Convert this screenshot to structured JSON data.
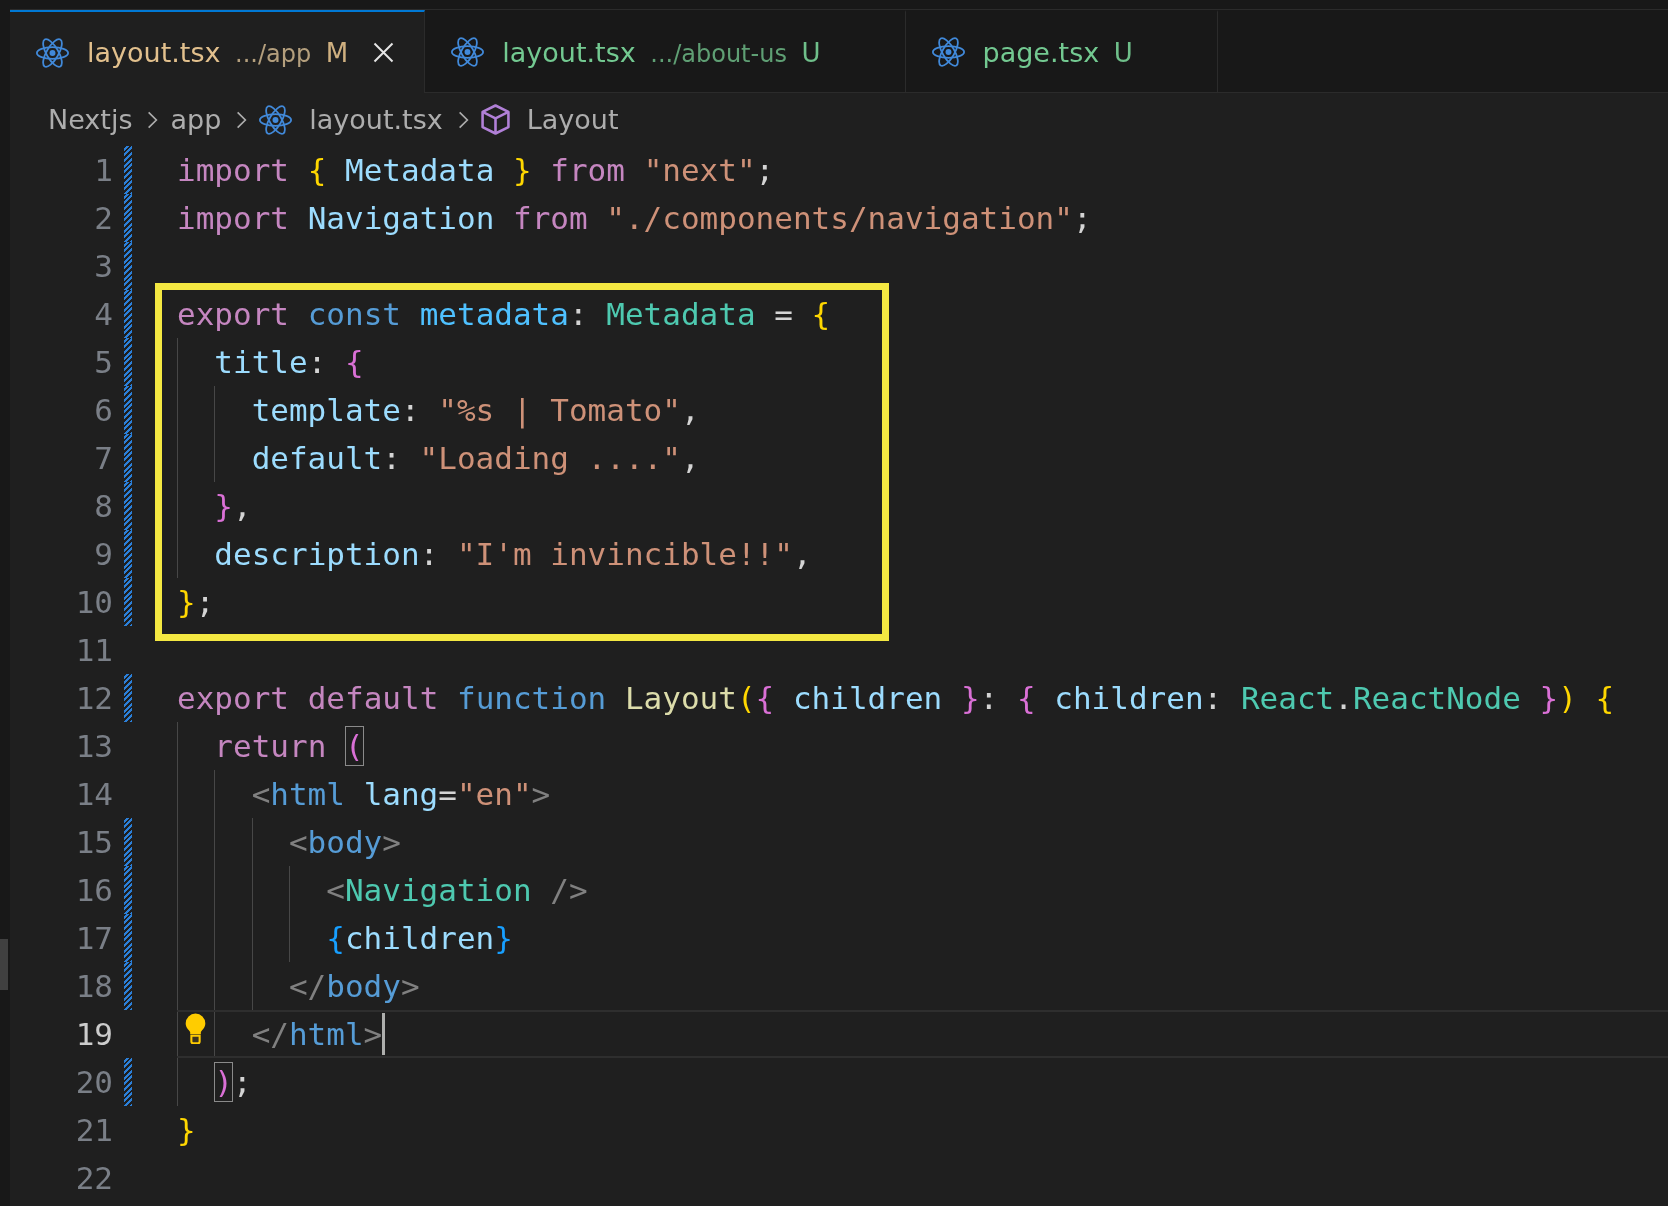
{
  "tabs": [
    {
      "file": "layout.tsx",
      "description": ".../app",
      "status": "M",
      "kind": "modified",
      "selected": true
    },
    {
      "file": "layout.tsx",
      "description": ".../about-us",
      "status": "U",
      "kind": "untracked",
      "selected": false
    },
    {
      "file": "page.tsx",
      "status": "U",
      "kind": "untracked",
      "selected": false
    }
  ],
  "breadcrumbs": [
    {
      "kind": "folder",
      "text": "Nextjs"
    },
    {
      "kind": "folder",
      "text": "app"
    },
    {
      "kind": "file",
      "text": "layout.tsx"
    },
    {
      "kind": "symbol",
      "text": "Layout"
    }
  ],
  "editor": {
    "lines": [
      {
        "kind": "line",
        "number": "1",
        "changed": true,
        "current": false,
        "lightbulb": false,
        "tokens": [
          {
            "text": "import ",
            "kind": "keyword"
          },
          {
            "text": "{ ",
            "kind": "bracket1"
          },
          {
            "text": "Metadata ",
            "kind": "variable"
          },
          {
            "text": "} ",
            "kind": "bracket1"
          },
          {
            "text": "from ",
            "kind": "keyword"
          },
          {
            "text": "\"next\"",
            "kind": "string"
          },
          {
            "text": ";",
            "kind": "punctuation"
          }
        ]
      },
      {
        "kind": "line",
        "number": "2",
        "changed": true,
        "current": false,
        "lightbulb": false,
        "tokens": [
          {
            "text": "import ",
            "kind": "keyword"
          },
          {
            "text": "Navigation ",
            "kind": "variable"
          },
          {
            "text": "from ",
            "kind": "keyword"
          },
          {
            "text": "\"./components/navigation\"",
            "kind": "string"
          },
          {
            "text": ";",
            "kind": "punctuation"
          }
        ]
      },
      {
        "kind": "line",
        "number": "3",
        "changed": true,
        "current": false,
        "lightbulb": false
      },
      {
        "kind": "highlight",
        "lines": [
          {
            "number": "4",
            "changed": true,
            "current": false,
            "lightbulb": false,
            "tokens": [
              {
                "text": "export ",
                "kind": "keyword"
              },
              {
                "text": "const ",
                "kind": "storage"
              },
              {
                "text": "metadata",
                "kind": "constant"
              },
              {
                "text": ": ",
                "kind": "punctuation"
              },
              {
                "text": "Metadata ",
                "kind": "type"
              },
              {
                "text": "= ",
                "kind": "punctuation"
              },
              {
                "text": "{",
                "kind": "bracket1"
              }
            ],
            "children": [
              {
                "number": "5",
                "changed": true,
                "current": false,
                "lightbulb": false,
                "tokens": [
                  {
                    "text": "title",
                    "kind": "property"
                  },
                  {
                    "text": ": ",
                    "kind": "punctuation"
                  },
                  {
                    "text": "{",
                    "kind": "bracket2"
                  }
                ],
                "children": [
                  {
                    "number": "6",
                    "changed": true,
                    "current": false,
                    "lightbulb": false,
                    "tokens": [
                      {
                        "text": "template",
                        "kind": "property"
                      },
                      {
                        "text": ": ",
                        "kind": "punctuation"
                      },
                      {
                        "text": "\"%s | Tomato\"",
                        "kind": "string"
                      },
                      {
                        "text": ",",
                        "kind": "punctuation"
                      }
                    ]
                  },
                  {
                    "number": "7",
                    "changed": true,
                    "current": false,
                    "lightbulb": false,
                    "tokens": [
                      {
                        "text": "default",
                        "kind": "property"
                      },
                      {
                        "text": ": ",
                        "kind": "punctuation"
                      },
                      {
                        "text": "\"Loading ....\"",
                        "kind": "string"
                      },
                      {
                        "text": ",",
                        "kind": "punctuation"
                      }
                    ]
                  }
                ]
              },
              {
                "number": "8",
                "changed": true,
                "current": false,
                "lightbulb": false,
                "tokens": [
                  {
                    "text": "}",
                    "kind": "bracket2"
                  },
                  {
                    "text": ",",
                    "kind": "punctuation"
                  }
                ]
              },
              {
                "number": "9",
                "changed": true,
                "current": false,
                "lightbulb": false,
                "tokens": [
                  {
                    "text": "description",
                    "kind": "property"
                  },
                  {
                    "text": ": ",
                    "kind": "punctuation"
                  },
                  {
                    "text": "\"I'm invincible!!\"",
                    "kind": "string"
                  },
                  {
                    "text": ",",
                    "kind": "punctuation"
                  }
                ]
              }
            ]
          },
          {
            "number": "10",
            "changed": true,
            "current": false,
            "lightbulb": false,
            "tokens": [
              {
                "text": "}",
                "kind": "bracket1"
              },
              {
                "text": ";",
                "kind": "punctuation"
              }
            ]
          }
        ]
      },
      {
        "kind": "line",
        "number": "11",
        "changed": false,
        "current": false,
        "lightbulb": false
      },
      {
        "kind": "line",
        "number": "12",
        "changed": true,
        "current": false,
        "lightbulb": false,
        "tokens": [
          {
            "text": "export ",
            "kind": "keyword"
          },
          {
            "text": "default ",
            "kind": "keyword"
          },
          {
            "text": "function ",
            "kind": "storage"
          },
          {
            "text": "Layout",
            "kind": "function"
          },
          {
            "text": "(",
            "kind": "bracket1"
          },
          {
            "text": "{ ",
            "kind": "bracket2"
          },
          {
            "text": "children ",
            "kind": "property"
          },
          {
            "text": "}",
            "kind": "bracket2"
          },
          {
            "text": ": ",
            "kind": "punctuation"
          },
          {
            "text": "{ ",
            "kind": "bracket2"
          },
          {
            "text": "children",
            "kind": "property"
          },
          {
            "text": ": ",
            "kind": "punctuation"
          },
          {
            "text": "React",
            "kind": "type"
          },
          {
            "text": ".",
            "kind": "punctuation"
          },
          {
            "text": "ReactNode ",
            "kind": "type"
          },
          {
            "text": "}",
            "kind": "bracket2"
          },
          {
            "text": ") {",
            "kind": "bracket1"
          }
        ],
        "children": [
          {
            "number": "13",
            "changed": false,
            "current": false,
            "lightbulb": false,
            "tokens": [
              {
                "text": "return ",
                "kind": "keyword"
              },
              {
                "text": "(",
                "kind": "bracket2",
                "matched": true
              }
            ],
            "children": [
              {
                "number": "14",
                "changed": false,
                "current": false,
                "lightbulb": false,
                "tokens": [
                  {
                    "text": "<",
                    "kind": "tag_bracket"
                  },
                  {
                    "text": "html ",
                    "kind": "tag"
                  },
                  {
                    "text": "lang",
                    "kind": "attribute"
                  },
                  {
                    "text": "=",
                    "kind": "punctuation"
                  },
                  {
                    "text": "\"en\"",
                    "kind": "string"
                  },
                  {
                    "text": ">",
                    "kind": "tag_bracket"
                  }
                ],
                "children": [
                  {
                    "number": "15",
                    "changed": true,
                    "current": false,
                    "lightbulb": false,
                    "tokens": [
                      {
                        "text": "<",
                        "kind": "tag_bracket"
                      },
                      {
                        "text": "body",
                        "kind": "tag"
                      },
                      {
                        "text": ">",
                        "kind": "tag_bracket"
                      }
                    ],
                    "children": [
                      {
                        "number": "16",
                        "changed": true,
                        "current": false,
                        "lightbulb": false,
                        "tokens": [
                          {
                            "text": "<",
                            "kind": "tag_bracket"
                          },
                          {
                            "text": "Navigation ",
                            "kind": "component"
                          },
                          {
                            "text": "/>",
                            "kind": "tag_bracket"
                          }
                        ]
                      },
                      {
                        "number": "17",
                        "changed": true,
                        "current": false,
                        "lightbulb": false,
                        "tokens": [
                          {
                            "text": "{",
                            "kind": "bracket3"
                          },
                          {
                            "text": "children",
                            "kind": "property"
                          },
                          {
                            "text": "}",
                            "kind": "bracket3"
                          }
                        ]
                      }
                    ]
                  },
                  {
                    "number": "18",
                    "changed": true,
                    "current": false,
                    "lightbulb": false,
                    "tokens": [
                      {
                        "text": "</",
                        "kind": "tag_bracket"
                      },
                      {
                        "text": "body",
                        "kind": "tag"
                      },
                      {
                        "text": ">",
                        "kind": "tag_bracket"
                      }
                    ]
                  }
                ]
              },
              {
                "number": "19",
                "changed": false,
                "current": true,
                "lightbulb": true,
                "tokens": [
                  {
                    "text": "</",
                    "kind": "tag_bracket"
                  },
                  {
                    "text": "html",
                    "kind": "tag"
                  },
                  {
                    "text": ">",
                    "kind": "tag_bracket"
                  }
                ]
              }
            ]
          },
          {
            "number": "20",
            "changed": true,
            "current": false,
            "lightbulb": false,
            "tokens": [
              {
                "text": ")",
                "kind": "bracket2",
                "matched": true
              },
              {
                "text": ";",
                "kind": "punctuation"
              }
            ]
          }
        ]
      },
      {
        "kind": "line",
        "number": "21",
        "changed": false,
        "current": false,
        "lightbulb": false,
        "tokens": [
          {
            "text": "}",
            "kind": "bracket1"
          }
        ]
      },
      {
        "kind": "line",
        "number": "22",
        "changed": false,
        "current": false,
        "lightbulb": false
      }
    ]
  }
}
